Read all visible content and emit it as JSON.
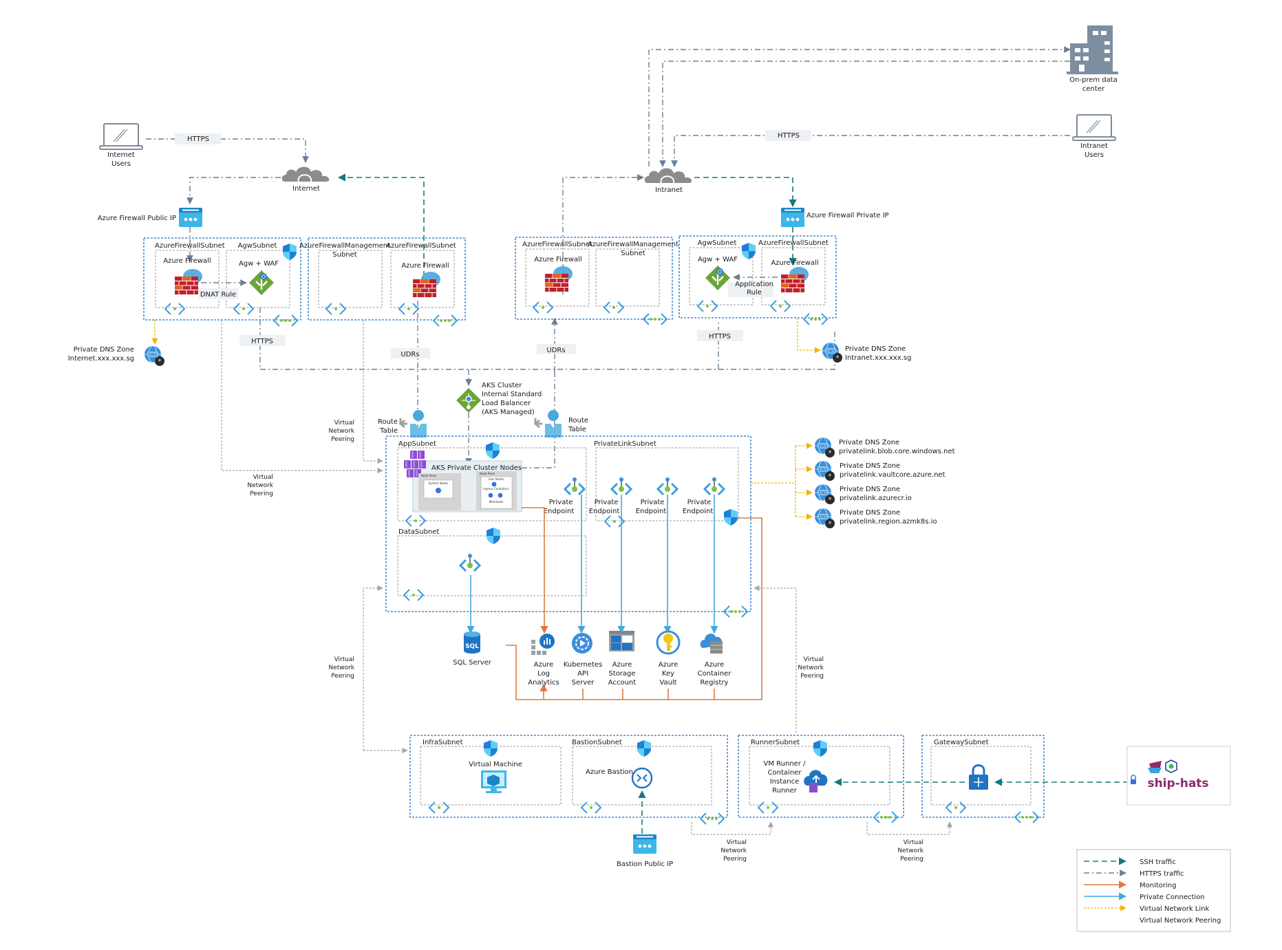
{
  "external": {
    "internet_users": [
      "Internet",
      "Users"
    ],
    "intranet_users": [
      "Intranet",
      "Users"
    ],
    "onprem": [
      "On-prem data",
      "center"
    ],
    "internet_cloud": "Internet",
    "intranet_cloud": "Intranet",
    "https_tag_left": "HTTPS",
    "https_tag_right": "HTTPS"
  },
  "internet_zone": {
    "public_ip_label": "Azure Firewall Public IP",
    "subnet_fw": "AzureFirewallSubnet",
    "subnet_agw": "AgwSubnet",
    "subnet_mgmt": [
      "AzureFirewallManagement",
      "Subnet"
    ],
    "subnet_fw2": "AzureFirewallSubnet",
    "firewall_label": "Azure Firewall",
    "firewall2_label": "Azure Firewall",
    "agw_label": "Agw + WAF",
    "dnat_rule": "DNAT Rule",
    "https_tag": "HTTPS",
    "udrs_tag": "UDRs",
    "dns_zone": [
      "Private DNS Zone",
      "Internet.xxx.xxx.sg"
    ]
  },
  "intranet_zone": {
    "public_ip_label": "Azure Firewall Private IP",
    "subnet_fw": "AzureFirewallSubnet",
    "subnet_mgmt": [
      "AzureFirewallManagement",
      "Subnet"
    ],
    "subnet_agw": "AgwSubnet",
    "subnet_fw2": "AzureFirewallSubnet",
    "firewall_label": "Azure Firewall",
    "firewall2_label": "Azure Firewall",
    "agw_label": "Agw + WAF",
    "app_rule": [
      "Application",
      "Rule"
    ],
    "https_tag": "HTTPS",
    "udrs_tag": "UDRs",
    "dns_zone": [
      "Private DNS Zone",
      "Intranet.xxx.xxx.sg"
    ]
  },
  "aks": {
    "lb_label": [
      "AKS Cluster",
      "Internal Standard",
      "Load Balancer",
      "(AKS Managed)"
    ],
    "route_table_left": [
      "Route",
      "Table"
    ],
    "route_table_right": [
      "Route",
      "Table"
    ],
    "app_subnet": "AppSubnet",
    "private_link_subnet": "PrivateLinkSubnet",
    "data_subnet": "DataSubnet",
    "cluster_title": "AKS Private Cluster Nodes",
    "node_pool_1": "Node Pools",
    "node_pool_2": "Node Pools",
    "system_nodes": "System Nodes",
    "user_nodes": "User Nodes",
    "ingress": "Ingress Controllers",
    "workloads": "Workloads",
    "private_endpoints": [
      [
        "Private",
        "Endpoint"
      ],
      [
        "Private",
        "Endpoint"
      ],
      [
        "Private",
        "Endpoint"
      ],
      [
        "Private",
        "Endpoint"
      ]
    ]
  },
  "private_dns_zones": [
    [
      "Private DNS Zone",
      "privatelink.blob.core.windows.net"
    ],
    [
      "Private DNS Zone",
      "privatelink.vaultcore.azure.net"
    ],
    [
      "Private DNS Zone",
      "privatelink.azurecr.io"
    ],
    [
      "Private DNS Zone",
      "privatelink.region.azmk8s.io"
    ]
  ],
  "services": {
    "sql": "SQL Server",
    "log_analytics": [
      "Azure",
      "Log",
      "Analytics"
    ],
    "k8s_api": [
      "Kubernetes",
      "API",
      "Server"
    ],
    "storage": [
      "Azure",
      "Storage",
      "Account"
    ],
    "keyvault": [
      "Azure",
      "Key",
      "Vault"
    ],
    "acr": [
      "Azure",
      "Container",
      "Registry"
    ]
  },
  "peering_labels": [
    [
      "Virtual",
      "Network",
      "Peering"
    ],
    [
      "Virtual",
      "Network",
      "Peering"
    ],
    [
      "Virtual",
      "Network",
      "Peering"
    ],
    [
      "Virtual",
      "Network",
      "Peering"
    ],
    [
      "Virtual",
      "Network",
      "Peering"
    ],
    [
      "Virtual",
      "Network",
      "Peering"
    ]
  ],
  "infra": {
    "infra_subnet": "InfraSubnet",
    "bastion_subnet": "BastionSubnet",
    "vm_label": "Virtual Machine",
    "bastion_label": "Azure Bastion",
    "bastion_ip": "Bastion Public IP"
  },
  "runner": {
    "runner_subnet": "RunnerSubnet",
    "runner_label": [
      "VM Runner /",
      "Container",
      "Instance",
      "Runner"
    ],
    "gateway_subnet": "GatewaySubnet",
    "shiphats": "ship-hats"
  },
  "legend": {
    "items": [
      {
        "label": "SSH traffic",
        "style": "ssh",
        "color": "#137b7b"
      },
      {
        "label": "HTTPS traffic",
        "style": "https",
        "color": "#6a7f95"
      },
      {
        "label": "Monitoring",
        "style": "monitoring",
        "color": "#e0783c"
      },
      {
        "label": "Private Connection",
        "style": "private",
        "color": "#43a9dc"
      },
      {
        "label": "Virtual Network Link",
        "style": "vlink",
        "color": "#f2b400"
      },
      {
        "label": "Virtual Network Peering",
        "style": "peering",
        "color": "#a7a7a7"
      }
    ]
  },
  "colors": {
    "vnet_border": "#1f74c4",
    "ssh": "#137b7b",
    "https": "#6a7f95",
    "monitoring": "#e0783c",
    "private": "#43a9dc",
    "vnet_link": "#f2b400",
    "peering": "#a7a7a7",
    "shiphats_brand": "#8b2a6e"
  }
}
